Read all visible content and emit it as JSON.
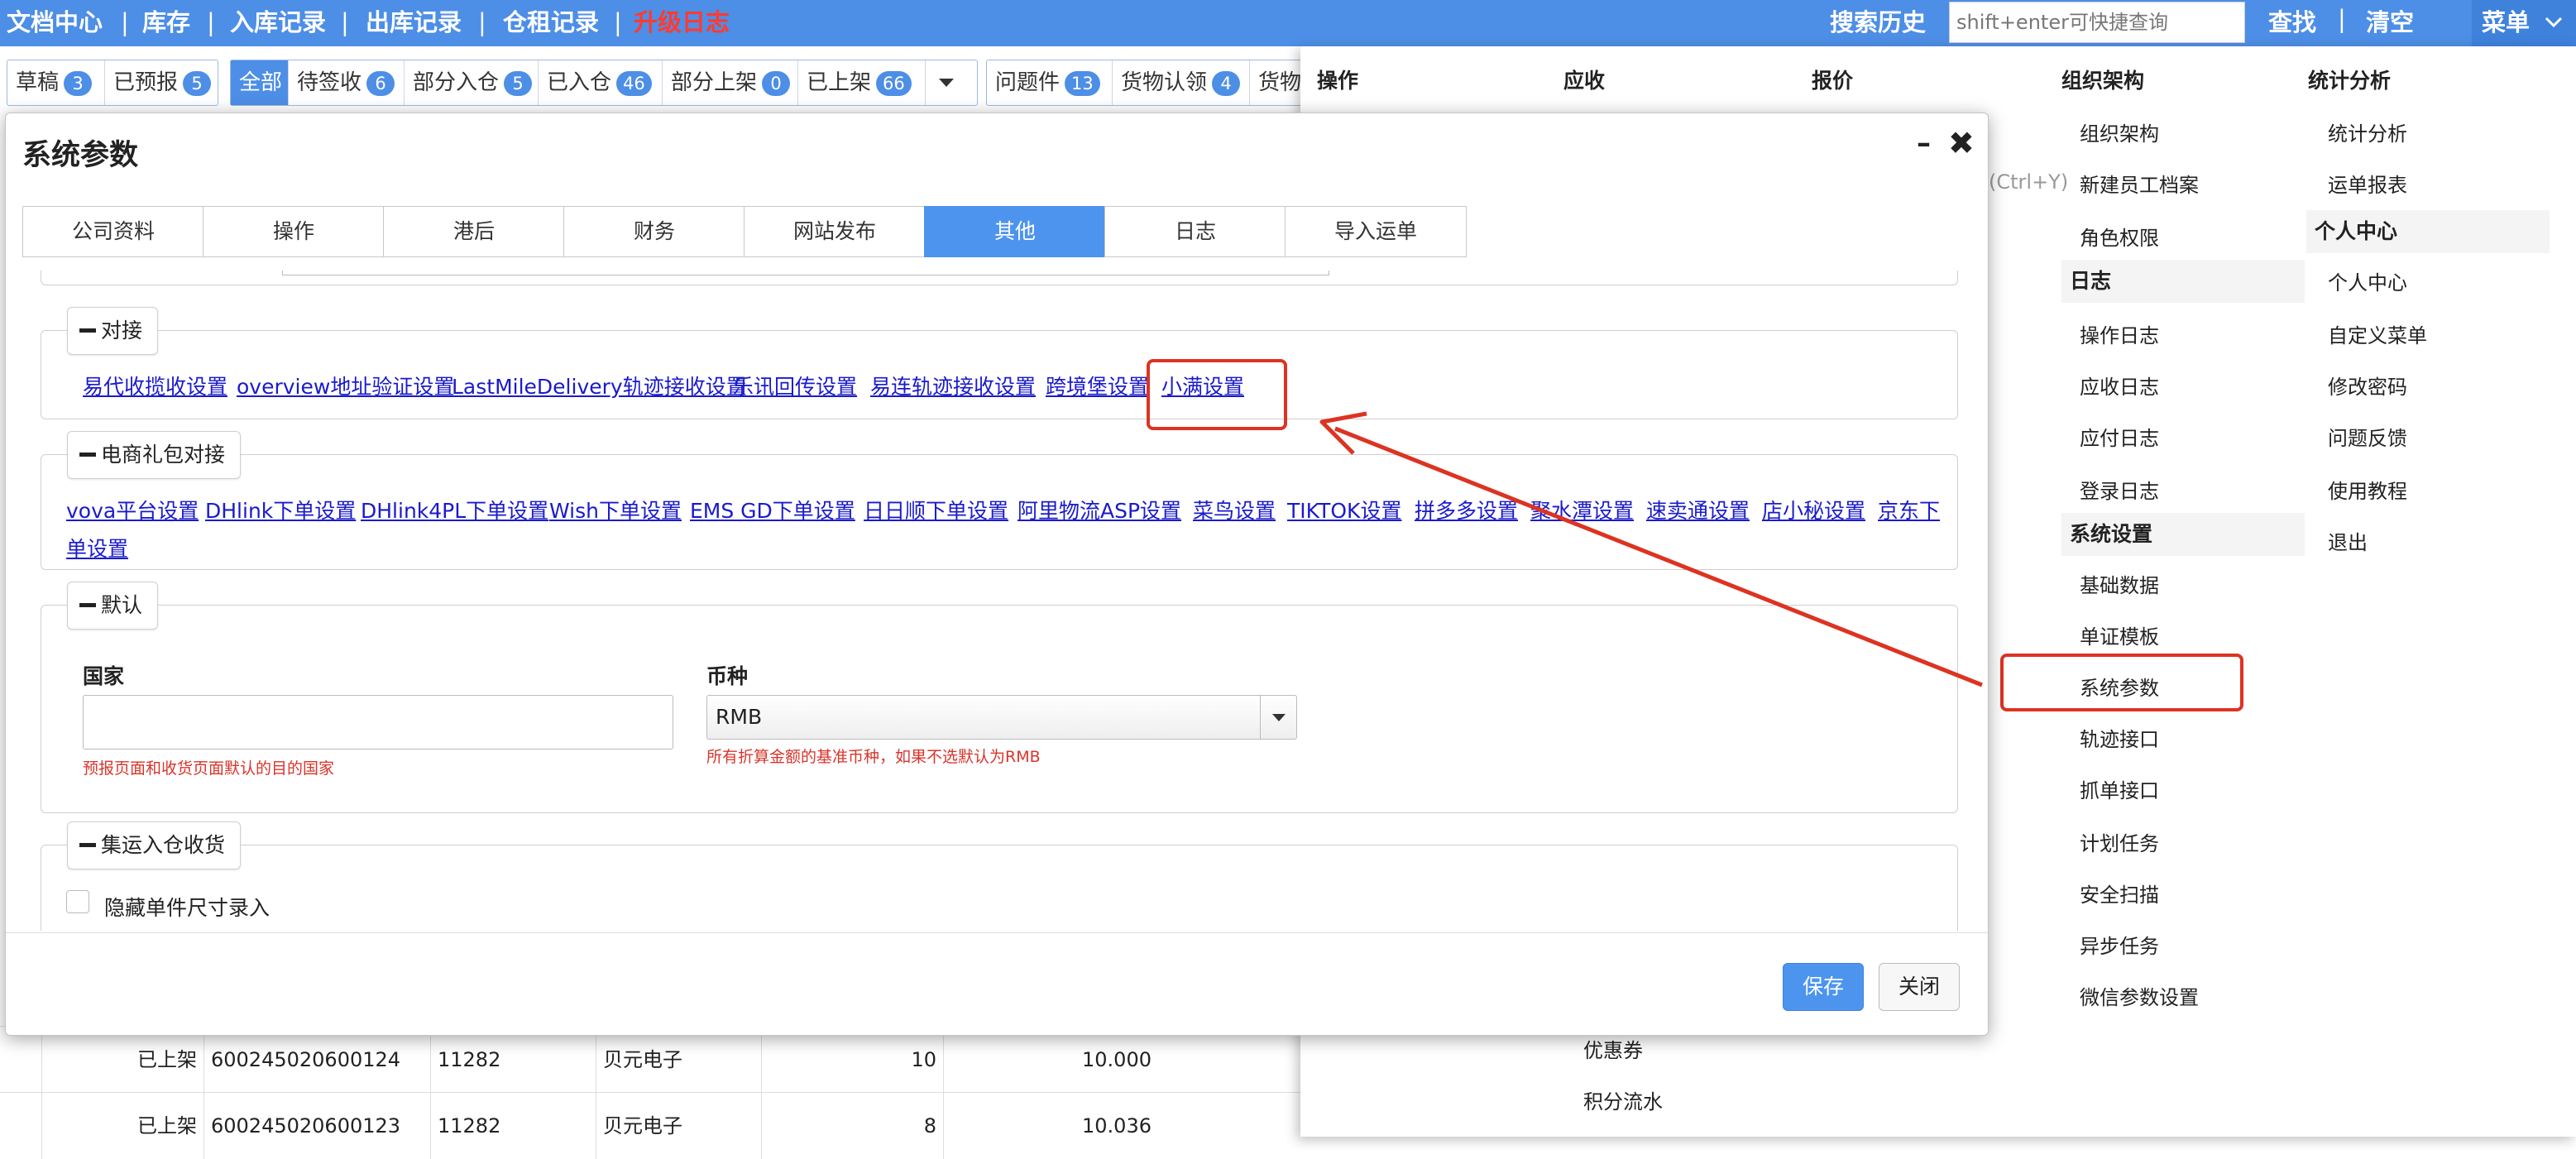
{
  "topnav": {
    "items": [
      "文档中心",
      "库存",
      "入库记录",
      "出库记录",
      "仓租记录",
      "升级日志"
    ],
    "search_history": "搜索历史",
    "search_placeholder": "shift+enter可快捷查询",
    "find": "查找",
    "clear": "清空",
    "menu": "菜单",
    "upgrade_color": "#ff3b30"
  },
  "filters": {
    "group1": [
      {
        "label": "草稿",
        "count": "3"
      },
      {
        "label": "已预报",
        "count": "5"
      }
    ],
    "group2": [
      {
        "label": "全部",
        "count": ""
      },
      {
        "label": "待签收",
        "count": "6"
      },
      {
        "label": "部分入仓",
        "count": "5"
      },
      {
        "label": "已入仓",
        "count": "46"
      },
      {
        "label": "部分上架",
        "count": "0"
      },
      {
        "label": "已上架",
        "count": "66"
      }
    ],
    "group3": [
      {
        "label": "问题件",
        "count": "13"
      },
      {
        "label": "货物认领",
        "count": "4"
      },
      {
        "label": "货物",
        "count": ""
      }
    ]
  },
  "bg_rows": [
    {
      "status": "已上架",
      "code": "600245020600124",
      "num": "11282",
      "name": "贝元电子",
      "qty": "10",
      "weight": "10.000"
    },
    {
      "status": "已上架",
      "code": "600245020600123",
      "num": "11282",
      "name": "贝元电子",
      "qty": "8",
      "weight": "10.036"
    }
  ],
  "megamenu": {
    "headers": [
      "操作",
      "应收",
      "报价",
      "组织架构",
      "统计分析"
    ],
    "shortcut_hint": "(Ctrl+Y)",
    "col_org": [
      "组织架构",
      "新建员工档案",
      "角色权限"
    ],
    "log_section": "日志",
    "col_log": [
      "操作日志",
      "应收日志",
      "应付日志",
      "登录日志"
    ],
    "sys_section": "系统设置",
    "col_sys": [
      "基础数据",
      "单证模板",
      "系统参数",
      "轨迹接口",
      "抓单接口",
      "计划任务",
      "安全扫描",
      "异步任务",
      "微信参数设置"
    ],
    "col_stats": [
      "统计分析",
      "运单报表"
    ],
    "personal_section": "个人中心",
    "col_personal": [
      "个人中心",
      "自定义菜单",
      "修改密码",
      "问题反馈",
      "使用教程",
      "退出"
    ],
    "extra_items": [
      "优惠券",
      "积分流水"
    ]
  },
  "modal": {
    "title": "系统参数",
    "minimize": "–",
    "close": "✖",
    "tabs": [
      "公司资料",
      "操作",
      "港后",
      "财务",
      "网站发布",
      "其他",
      "日志",
      "导入运单"
    ],
    "active_tab": 5,
    "sections": {
      "duijie": {
        "legend": "对接",
        "links": [
          "易代收揽收设置",
          "overview地址验证设置",
          "LastMileDelivery轨迹接收设置",
          "乐讯回传设置",
          "易连轨迹接收设置",
          "跨境堡设置",
          "小满设置"
        ]
      },
      "dianshang": {
        "legend": "电商礼包对接",
        "links": [
          "vova平台设置",
          "DHlink下单设置",
          "DHlink4PL下单设置",
          "Wish下单设置",
          "EMS GD下单设置",
          "日日顺下单设置",
          "阿里物流ASP设置",
          "菜鸟设置",
          "TIKTOK设置",
          "拼多多设置",
          "聚水潭设置",
          "速卖通设置",
          "店小秘设置",
          "京东下"
        ],
        "wrap_tail": "单设置"
      },
      "moren": {
        "legend": "默认",
        "country_label": "国家",
        "country_value": "",
        "country_hint": "预报页面和收货页面默认的目的国家",
        "currency_label": "币种",
        "currency_value": "RMB",
        "currency_hint": "所有折算金额的基准币种，如果不选默认为RMB"
      },
      "jiyun": {
        "legend": "集运入仓收货",
        "checkbox_label": "隐藏单件尺寸录入"
      }
    },
    "save": "保存",
    "close_btn": "关闭"
  },
  "annotation_color": "#dd3322"
}
